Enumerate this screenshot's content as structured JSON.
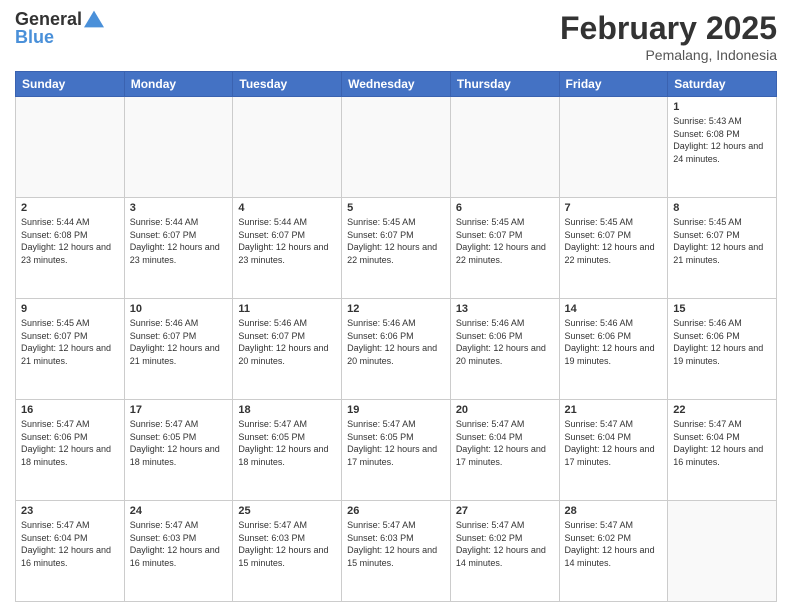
{
  "header": {
    "logo_line1": "General",
    "logo_line2": "Blue",
    "month_year": "February 2025",
    "location": "Pemalang, Indonesia"
  },
  "days_of_week": [
    "Sunday",
    "Monday",
    "Tuesday",
    "Wednesday",
    "Thursday",
    "Friday",
    "Saturday"
  ],
  "weeks": [
    {
      "days": [
        {
          "num": "",
          "empty": true
        },
        {
          "num": "",
          "empty": true
        },
        {
          "num": "",
          "empty": true
        },
        {
          "num": "",
          "empty": true
        },
        {
          "num": "",
          "empty": true
        },
        {
          "num": "",
          "empty": true
        },
        {
          "num": "1",
          "sunrise": "5:43 AM",
          "sunset": "6:08 PM",
          "daylight": "12 hours and 24 minutes."
        }
      ]
    },
    {
      "days": [
        {
          "num": "2",
          "sunrise": "5:44 AM",
          "sunset": "6:08 PM",
          "daylight": "12 hours and 23 minutes."
        },
        {
          "num": "3",
          "sunrise": "5:44 AM",
          "sunset": "6:07 PM",
          "daylight": "12 hours and 23 minutes."
        },
        {
          "num": "4",
          "sunrise": "5:44 AM",
          "sunset": "6:07 PM",
          "daylight": "12 hours and 23 minutes."
        },
        {
          "num": "5",
          "sunrise": "5:45 AM",
          "sunset": "6:07 PM",
          "daylight": "12 hours and 22 minutes."
        },
        {
          "num": "6",
          "sunrise": "5:45 AM",
          "sunset": "6:07 PM",
          "daylight": "12 hours and 22 minutes."
        },
        {
          "num": "7",
          "sunrise": "5:45 AM",
          "sunset": "6:07 PM",
          "daylight": "12 hours and 22 minutes."
        },
        {
          "num": "8",
          "sunrise": "5:45 AM",
          "sunset": "6:07 PM",
          "daylight": "12 hours and 21 minutes."
        }
      ]
    },
    {
      "days": [
        {
          "num": "9",
          "sunrise": "5:45 AM",
          "sunset": "6:07 PM",
          "daylight": "12 hours and 21 minutes."
        },
        {
          "num": "10",
          "sunrise": "5:46 AM",
          "sunset": "6:07 PM",
          "daylight": "12 hours and 21 minutes."
        },
        {
          "num": "11",
          "sunrise": "5:46 AM",
          "sunset": "6:07 PM",
          "daylight": "12 hours and 20 minutes."
        },
        {
          "num": "12",
          "sunrise": "5:46 AM",
          "sunset": "6:06 PM",
          "daylight": "12 hours and 20 minutes."
        },
        {
          "num": "13",
          "sunrise": "5:46 AM",
          "sunset": "6:06 PM",
          "daylight": "12 hours and 20 minutes."
        },
        {
          "num": "14",
          "sunrise": "5:46 AM",
          "sunset": "6:06 PM",
          "daylight": "12 hours and 19 minutes."
        },
        {
          "num": "15",
          "sunrise": "5:46 AM",
          "sunset": "6:06 PM",
          "daylight": "12 hours and 19 minutes."
        }
      ]
    },
    {
      "days": [
        {
          "num": "16",
          "sunrise": "5:47 AM",
          "sunset": "6:06 PM",
          "daylight": "12 hours and 18 minutes."
        },
        {
          "num": "17",
          "sunrise": "5:47 AM",
          "sunset": "6:05 PM",
          "daylight": "12 hours and 18 minutes."
        },
        {
          "num": "18",
          "sunrise": "5:47 AM",
          "sunset": "6:05 PM",
          "daylight": "12 hours and 18 minutes."
        },
        {
          "num": "19",
          "sunrise": "5:47 AM",
          "sunset": "6:05 PM",
          "daylight": "12 hours and 17 minutes."
        },
        {
          "num": "20",
          "sunrise": "5:47 AM",
          "sunset": "6:04 PM",
          "daylight": "12 hours and 17 minutes."
        },
        {
          "num": "21",
          "sunrise": "5:47 AM",
          "sunset": "6:04 PM",
          "daylight": "12 hours and 17 minutes."
        },
        {
          "num": "22",
          "sunrise": "5:47 AM",
          "sunset": "6:04 PM",
          "daylight": "12 hours and 16 minutes."
        }
      ]
    },
    {
      "days": [
        {
          "num": "23",
          "sunrise": "5:47 AM",
          "sunset": "6:04 PM",
          "daylight": "12 hours and 16 minutes."
        },
        {
          "num": "24",
          "sunrise": "5:47 AM",
          "sunset": "6:03 PM",
          "daylight": "12 hours and 16 minutes."
        },
        {
          "num": "25",
          "sunrise": "5:47 AM",
          "sunset": "6:03 PM",
          "daylight": "12 hours and 15 minutes."
        },
        {
          "num": "26",
          "sunrise": "5:47 AM",
          "sunset": "6:03 PM",
          "daylight": "12 hours and 15 minutes."
        },
        {
          "num": "27",
          "sunrise": "5:47 AM",
          "sunset": "6:02 PM",
          "daylight": "12 hours and 14 minutes."
        },
        {
          "num": "28",
          "sunrise": "5:47 AM",
          "sunset": "6:02 PM",
          "daylight": "12 hours and 14 minutes."
        },
        {
          "num": "",
          "empty": true
        }
      ]
    }
  ]
}
